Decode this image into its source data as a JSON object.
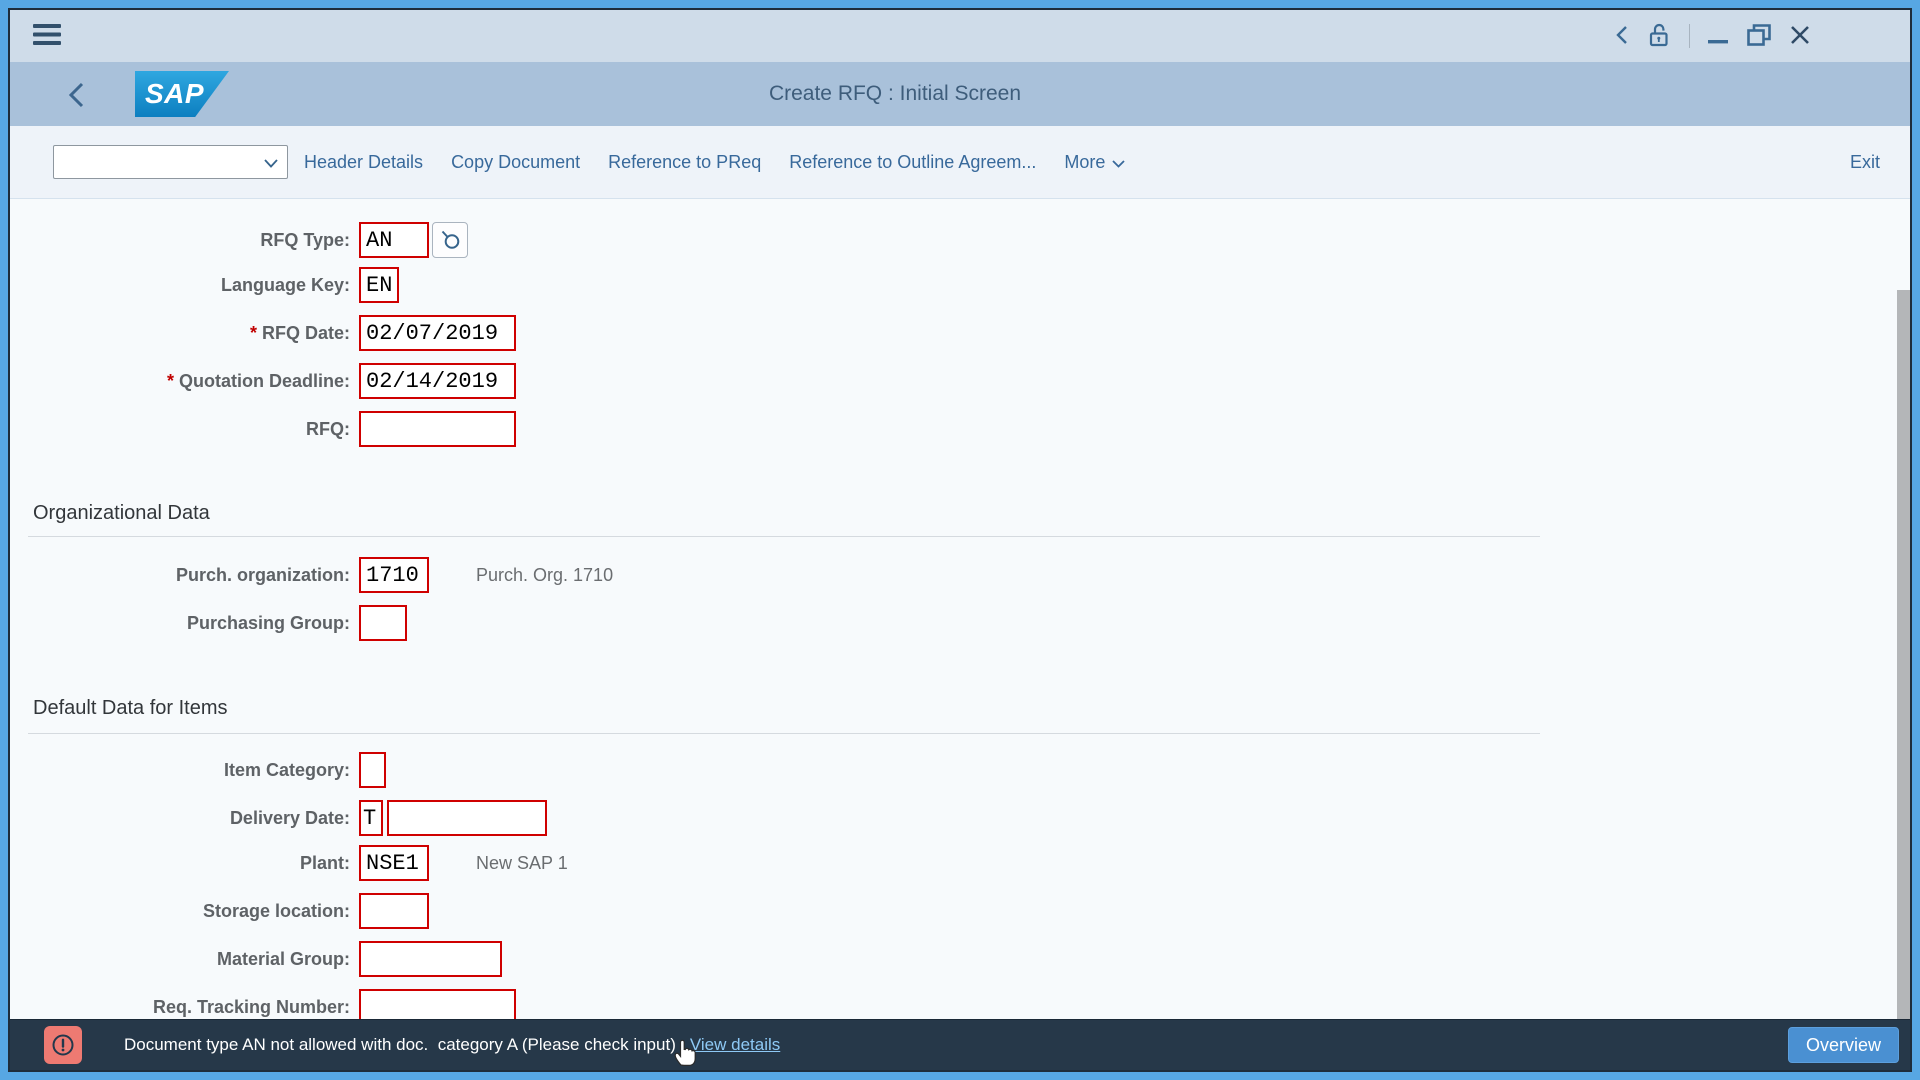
{
  "titlebar": {
    "menu_icon": "hamburger-menu"
  },
  "window_controls": {
    "nav_back_icon": "chevron-left",
    "lock_icon": "unlocked-padlock",
    "minimize_icon": "minimize-bar",
    "restore_icon": "overlapping-windows",
    "close_icon": "x-cross"
  },
  "header": {
    "logo": "SAP",
    "title": "Create RFQ : Initial Screen",
    "back_icon": "chevron-left"
  },
  "toolbar": {
    "dropdown_value": "",
    "links": {
      "header_details": "Header Details",
      "copy_document": "Copy Document",
      "ref_preq": "Reference to PReq",
      "ref_outline": "Reference to Outline Agreem...",
      "more": "More",
      "exit": "Exit"
    }
  },
  "form": {
    "sections": [
      {
        "title": "Organizational Data"
      },
      {
        "title": "Default Data for Items"
      }
    ],
    "rows": [
      {
        "label": "RFQ Type:",
        "value": "AN"
      },
      {
        "label": "Language Key:",
        "value": "EN"
      },
      {
        "label": "RFQ Date:",
        "required": "*",
        "value": "02/07/2019"
      },
      {
        "label": "Quotation Deadline:",
        "required": "*",
        "value": "02/14/2019"
      },
      {
        "label": "RFQ:",
        "value": ""
      },
      {
        "label": "Purch. organization:",
        "value": "1710",
        "desc": "Purch. Org. 1710"
      },
      {
        "label": "Purchasing Group:",
        "value": ""
      },
      {
        "label": "Item Category:",
        "value": ""
      },
      {
        "label": "Delivery Date:",
        "value": "T",
        "value2": ""
      },
      {
        "label": "Plant:",
        "value": "NSE1",
        "desc": "New SAP 1"
      },
      {
        "label": "Storage location:",
        "value": ""
      },
      {
        "label": "Material Group:",
        "value": ""
      },
      {
        "label": "Req. Tracking Number:",
        "value": ""
      }
    ]
  },
  "statusbar": {
    "error_icon": "exclamation-in-circle",
    "message": "Document type AN not allowed with doc.  category A (Please check input)",
    "details_link": "View details",
    "overview_button": "Overview",
    "cursor_icon": "hand-pointer"
  },
  "colors": {
    "frame_blue": "#57a7e3",
    "titlebar_bg": "#cfdce9",
    "header_bg": "#a9c1da",
    "toolbar_bg": "#eef3f9",
    "link_blue": "#38699b",
    "field_error_border": "#cf0000",
    "statusbar_bg": "#263849",
    "status_link": "#8ec9f5",
    "error_icon_bg": "#ee7a72",
    "overview_button_bg": "#4a90d2"
  }
}
